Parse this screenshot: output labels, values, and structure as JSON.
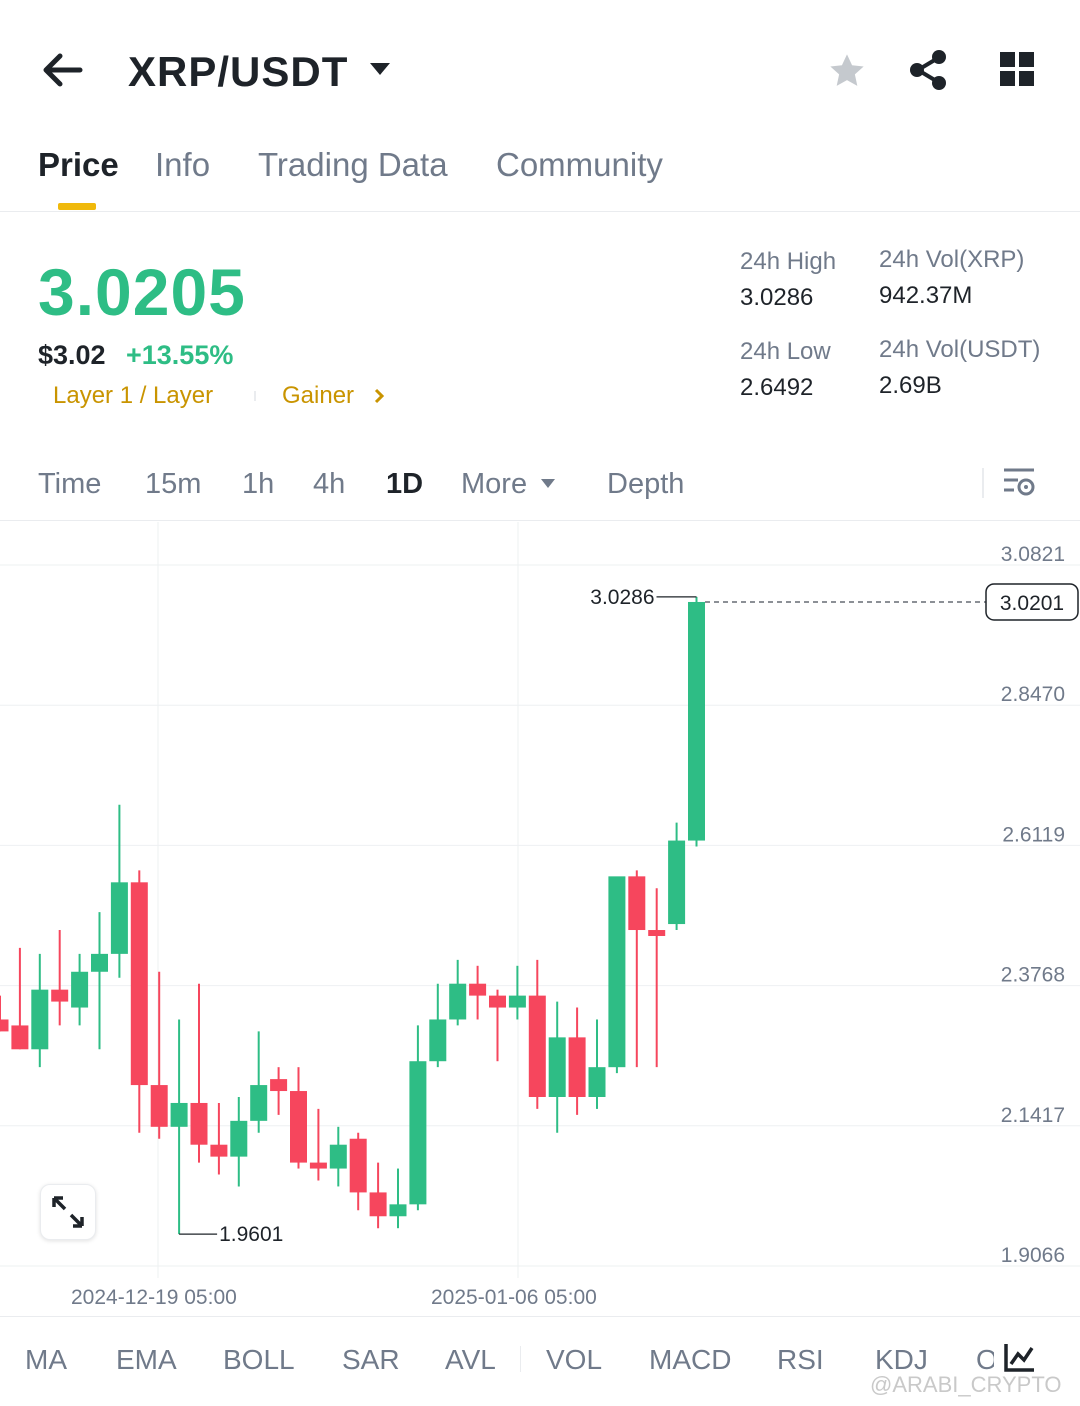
{
  "header": {
    "pair": "XRP/USDT"
  },
  "tabs": [
    {
      "label": "Price",
      "active": true
    },
    {
      "label": "Info",
      "active": false
    },
    {
      "label": "Trading Data",
      "active": false
    },
    {
      "label": "Community",
      "active": false
    }
  ],
  "ticker": {
    "last_price": "3.0205",
    "usd_price": "$3.02",
    "change": "+13.55%",
    "tag1": "Layer 1 / Layer",
    "tag2": "Gainer",
    "high_label": "24h High",
    "high_value": "3.0286",
    "low_label": "24h Low",
    "low_value": "2.6492",
    "vol_xrp_label": "24h Vol(XRP)",
    "vol_xrp_value": "942.37M",
    "vol_usdt_label": "24h Vol(USDT)",
    "vol_usdt_value": "2.69B"
  },
  "intervals": {
    "time": "Time",
    "m15": "15m",
    "h1": "1h",
    "h4": "4h",
    "d1": "1D",
    "more": "More",
    "depth": "Depth"
  },
  "indicators": [
    "MA",
    "EMA",
    "BOLL",
    "SAR",
    "AVL",
    "VOL",
    "MACD",
    "RSI",
    "KDJ",
    "O"
  ],
  "watermark": "@ARABI_CRYPTO",
  "colors": {
    "up": "#2ebd85",
    "down": "#f6465d",
    "accent": "#f0b90b",
    "tag": "#c99400"
  },
  "chart_data": {
    "type": "candlestick",
    "interval": "1D",
    "y_axis_ticks": [
      "3.0821",
      "2.8470",
      "2.6119",
      "2.3768",
      "2.1417",
      "1.9066"
    ],
    "ylim": [
      1.9066,
      3.0821
    ],
    "x_tick_labels": [
      "2024-12-19 05:00",
      "2025-01-06 05:00"
    ],
    "current_price_label": "3.0201",
    "current_price": 3.0201,
    "high_marker": {
      "label": "3.0286",
      "value": 3.0286
    },
    "low_marker": {
      "label": "1.9601",
      "value": 1.9601
    },
    "candles": [
      {
        "o": 2.32,
        "h": 2.36,
        "l": 2.3,
        "c": 2.3
      },
      {
        "o": 2.31,
        "h": 2.44,
        "l": 2.27,
        "c": 2.27
      },
      {
        "o": 2.27,
        "h": 2.43,
        "l": 2.24,
        "c": 2.37
      },
      {
        "o": 2.37,
        "h": 2.47,
        "l": 2.31,
        "c": 2.35
      },
      {
        "o": 2.34,
        "h": 2.43,
        "l": 2.31,
        "c": 2.4
      },
      {
        "o": 2.4,
        "h": 2.5,
        "l": 2.27,
        "c": 2.43
      },
      {
        "o": 2.43,
        "h": 2.68,
        "l": 2.39,
        "c": 2.55
      },
      {
        "o": 2.55,
        "h": 2.57,
        "l": 2.13,
        "c": 2.21
      },
      {
        "o": 2.21,
        "h": 2.4,
        "l": 2.12,
        "c": 2.14
      },
      {
        "o": 2.14,
        "h": 2.32,
        "l": 1.9601,
        "c": 2.18
      },
      {
        "o": 2.18,
        "h": 2.38,
        "l": 2.08,
        "c": 2.11
      },
      {
        "o": 2.11,
        "h": 2.18,
        "l": 2.06,
        "c": 2.09
      },
      {
        "o": 2.09,
        "h": 2.19,
        "l": 2.04,
        "c": 2.15
      },
      {
        "o": 2.15,
        "h": 2.3,
        "l": 2.13,
        "c": 2.21
      },
      {
        "o": 2.22,
        "h": 2.24,
        "l": 2.16,
        "c": 2.2
      },
      {
        "o": 2.2,
        "h": 2.24,
        "l": 2.07,
        "c": 2.08
      },
      {
        "o": 2.08,
        "h": 2.17,
        "l": 2.05,
        "c": 2.07
      },
      {
        "o": 2.07,
        "h": 2.14,
        "l": 2.04,
        "c": 2.11
      },
      {
        "o": 2.12,
        "h": 2.13,
        "l": 2.0,
        "c": 2.03
      },
      {
        "o": 2.03,
        "h": 2.08,
        "l": 1.97,
        "c": 1.99
      },
      {
        "o": 1.99,
        "h": 2.07,
        "l": 1.97,
        "c": 2.01
      },
      {
        "o": 2.01,
        "h": 2.31,
        "l": 2.0,
        "c": 2.25
      },
      {
        "o": 2.25,
        "h": 2.38,
        "l": 2.24,
        "c": 2.32
      },
      {
        "o": 2.32,
        "h": 2.42,
        "l": 2.31,
        "c": 2.38
      },
      {
        "o": 2.38,
        "h": 2.41,
        "l": 2.32,
        "c": 2.36
      },
      {
        "o": 2.36,
        "h": 2.37,
        "l": 2.25,
        "c": 2.34
      },
      {
        "o": 2.34,
        "h": 2.41,
        "l": 2.32,
        "c": 2.36
      },
      {
        "o": 2.36,
        "h": 2.42,
        "l": 2.17,
        "c": 2.19
      },
      {
        "o": 2.19,
        "h": 2.35,
        "l": 2.13,
        "c": 2.29
      },
      {
        "o": 2.29,
        "h": 2.34,
        "l": 2.16,
        "c": 2.19
      },
      {
        "o": 2.19,
        "h": 2.32,
        "l": 2.17,
        "c": 2.24
      },
      {
        "o": 2.24,
        "h": 2.55,
        "l": 2.23,
        "c": 2.56
      },
      {
        "o": 2.56,
        "h": 2.57,
        "l": 2.24,
        "c": 2.47
      },
      {
        "o": 2.47,
        "h": 2.54,
        "l": 2.24,
        "c": 2.46
      },
      {
        "o": 2.48,
        "h": 2.65,
        "l": 2.47,
        "c": 2.62
      },
      {
        "o": 2.62,
        "h": 3.0286,
        "l": 2.61,
        "c": 3.0201
      }
    ]
  }
}
